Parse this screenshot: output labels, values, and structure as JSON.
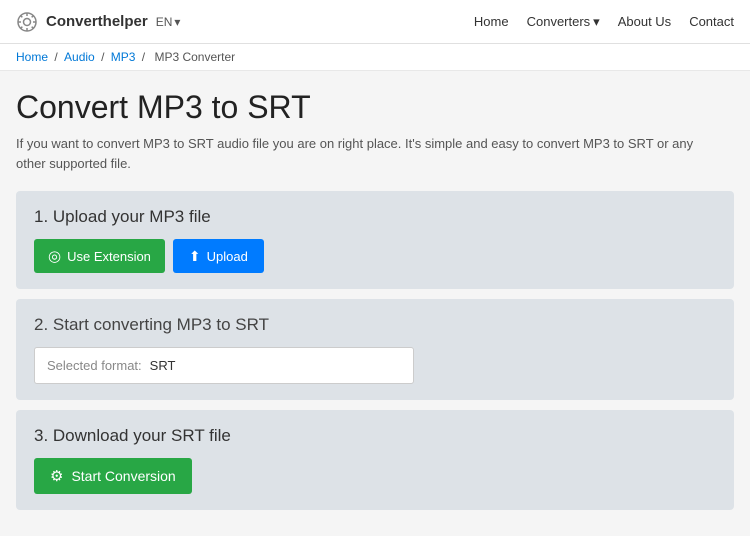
{
  "header": {
    "logo_text": "Converthelper",
    "lang": "EN",
    "lang_arrow": "▾",
    "nav": [
      {
        "label": "Home",
        "id": "home"
      },
      {
        "label": "Converters",
        "id": "converters",
        "dropdown": true
      },
      {
        "label": "About Us",
        "id": "about"
      },
      {
        "label": "Contact",
        "id": "contact"
      }
    ]
  },
  "breadcrumb": {
    "items": [
      {
        "label": "Home",
        "href": "#"
      },
      {
        "label": "Audio",
        "href": "#"
      },
      {
        "label": "MP3",
        "href": "#"
      },
      {
        "label": "MP3 Converter",
        "current": true
      }
    ],
    "separator": "/"
  },
  "page": {
    "title": "Convert MP3 to SRT",
    "description": "If you want to convert MP3 to SRT audio file you are on right place. It's simple and easy to convert MP3 to SRT or any other supported file."
  },
  "steps": [
    {
      "id": "upload",
      "title": "1. Upload your MP3 file",
      "buttons": [
        {
          "id": "extension",
          "label": "Use Extension",
          "type": "extension"
        },
        {
          "id": "upload",
          "label": "Upload",
          "type": "upload"
        }
      ]
    },
    {
      "id": "convert",
      "title": "2. Start converting MP3 to SRT",
      "format_label": "Selected format:",
      "format_value": "SRT"
    },
    {
      "id": "download",
      "title": "3. Download your SRT file",
      "button_label": "Start Conversion"
    }
  ],
  "icons": {
    "gear": "⚙",
    "upload": "⬆",
    "extension": "◎"
  }
}
